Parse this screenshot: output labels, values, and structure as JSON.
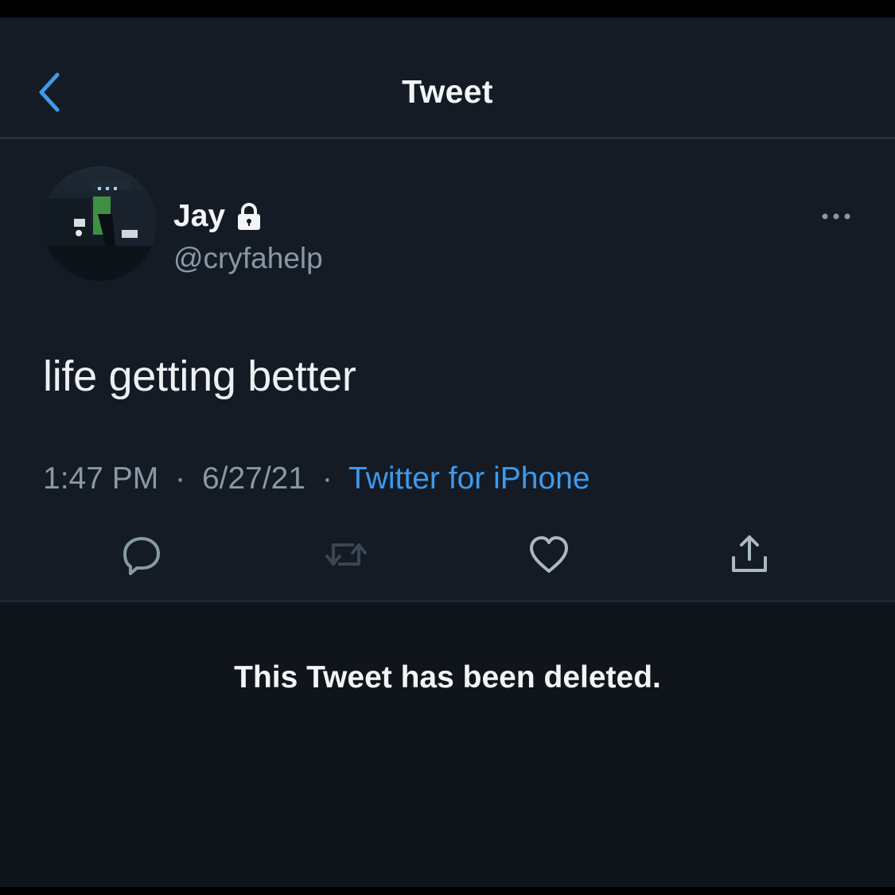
{
  "header": {
    "title": "Tweet"
  },
  "colors": {
    "background": "#141b24",
    "accent": "#3d9aec",
    "secondary_text": "#8899a6",
    "primary_text": "#f2f4f6"
  },
  "icons": {
    "back": "chevron-left-icon",
    "lock": "lock-icon",
    "more": "more-horizontal-icon",
    "reply": "reply-icon",
    "retweet": "retweet-icon",
    "like": "heart-icon",
    "share": "share-icon"
  },
  "tweet": {
    "display_name": "Jay",
    "username": "@cryfahelp",
    "text": "life getting better",
    "time": "1:47 PM",
    "date": "6/27/21",
    "source": "Twitter for iPhone",
    "separator": "·"
  },
  "deleted_notice": "This Tweet has been deleted."
}
